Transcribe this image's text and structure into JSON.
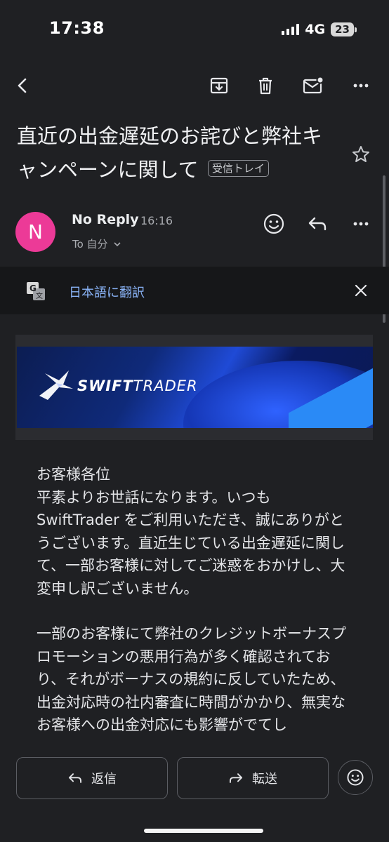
{
  "status_bar": {
    "time": "17:38",
    "network": "4G",
    "battery": "23"
  },
  "toolbar": {
    "back": "back-icon",
    "archive": "archive-icon",
    "delete": "trash-icon",
    "mark_unread": "mail-unread-icon",
    "more": "more-icon"
  },
  "email": {
    "subject": "直近の出金遅延のお詫びと弊社キャンペーンに関して",
    "label": "受信トレイ",
    "sender": {
      "initial": "N",
      "name": "No Reply",
      "time": "16:16",
      "recipient": "To 自分",
      "avatar_color": "#ec3a97"
    },
    "translate": {
      "label": "日本語に翻訳"
    },
    "banner": {
      "brand_bold": "SWIFT",
      "brand_light": "TRADER"
    },
    "body": [
      "お客様各位\n平素よりお世話になります。いつもSwiftTrader をご利用いただき、誠にありがとうございます。直近生じている出金遅延に関して、一部お客様に対してご迷惑をおかけし、大変申し訳ございません。",
      "一部のお客様にて弊社のクレジットボーナスプロモーションの悪用行為が多く確認されており、それがボーナスの規約に反していたため、出金対応時の社内審査に時間がかかり、無実なお客様への出金対応にも影響がでてし"
    ]
  },
  "actions": {
    "reply": "返信",
    "forward": "転送"
  },
  "colors": {
    "background": "#1f2023",
    "link": "#8ab4f8"
  }
}
